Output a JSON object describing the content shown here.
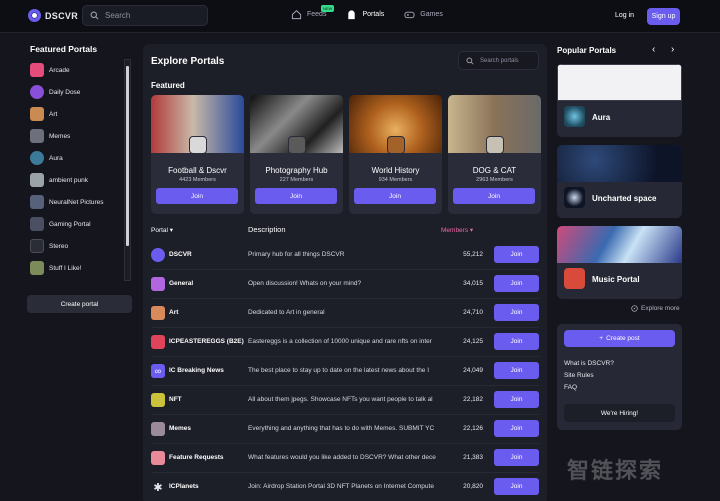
{
  "header": {
    "brand": "DSCVR",
    "search_placeholder": "Search",
    "tabs": [
      {
        "label": "Feeds",
        "badge": "NEW"
      },
      {
        "label": "Portals"
      },
      {
        "label": "Games"
      }
    ],
    "login": "Log in",
    "signup": "Sign up"
  },
  "sidebar": {
    "title": "Featured Portals",
    "items": [
      {
        "label": "Arcade",
        "color": "#e44d7b"
      },
      {
        "label": "Daily Dose",
        "color": "#8a4fd8"
      },
      {
        "label": "Art",
        "color": "#c98b52"
      },
      {
        "label": "Memes",
        "color": "#6d6f7c"
      },
      {
        "label": "Aura",
        "color": "#3c7a9a"
      },
      {
        "label": "ambient punk",
        "color": "#9aa3a8"
      },
      {
        "label": "NeuralNet Pictures",
        "color": "#58617a"
      },
      {
        "label": "Gaming Portal",
        "color": "#4a4f62"
      },
      {
        "label": "Stereo",
        "color": "#2a2c36"
      },
      {
        "label": "Stuff I Like!",
        "color": "#7b8b5a"
      }
    ],
    "create_portal": "Create portal"
  },
  "main": {
    "title": "Explore Portals",
    "search_placeholder": "Search portals",
    "featured_label": "Featured",
    "featured": [
      {
        "name": "Football & Dscvr",
        "members": "4423 Members",
        "join": "Join",
        "banner": "#a83a3a",
        "banner2": "#2a4a9a",
        "avatar": "#d9d9d9"
      },
      {
        "name": "Photography Hub",
        "members": "227 Members",
        "join": "Join",
        "banner": "#6b6b6b",
        "banner2": "#111111",
        "avatar": "#5a5a5a"
      },
      {
        "name": "World History",
        "members": "934 Members",
        "join": "Join",
        "banner": "#c9762f",
        "banner2": "#7a3c14",
        "avatar": "#a3622a"
      },
      {
        "name": "DOG & CAT",
        "members": "2963 Members",
        "join": "Join",
        "banner": "#8a7a62",
        "banner2": "#c9b590",
        "avatar": "#c7c0b5"
      }
    ],
    "table": {
      "col_portal": "Portal",
      "col_description": "Description",
      "col_members": "Members",
      "rows": [
        {
          "name": "DSCVR",
          "description": "Primary hub for all things DSCVR",
          "members": "55,212",
          "join": "Join",
          "color": "#6b5cf0"
        },
        {
          "name": "General",
          "description": "Open discussion! Whats on your mind?",
          "members": "34,015",
          "join": "Join",
          "color": "#b267e0"
        },
        {
          "name": "Art",
          "description": "Dedicated to Art in general",
          "members": "24,710",
          "join": "Join",
          "color": "#d88a5a"
        },
        {
          "name": "ICPEASTEREGGS (B2E)",
          "description": "Eastereggs is a collection of 10000 unique and rare nfts on inter",
          "members": "24,125",
          "join": "Join",
          "color": "#e0445a"
        },
        {
          "name": "IC Breaking News",
          "description": "The best place to stay up to date on the latest news about the I",
          "members": "24,049",
          "join": "Join",
          "color": "#6b5cf0"
        },
        {
          "name": "NFT",
          "description": "All about them jpegs. Showcase NFTs you want people to talk al",
          "members": "22,182",
          "join": "Join",
          "color": "#c9c23a"
        },
        {
          "name": "Memes",
          "description": "Everything and anything that has to do with Memes. SUBMIT YC",
          "members": "22,126",
          "join": "Join",
          "color": "#9a8a9a"
        },
        {
          "name": "Feature Requests",
          "description": "What features would you like added to DSCVR? What other dece",
          "members": "21,383",
          "join": "Join",
          "color": "#e88a9a"
        },
        {
          "name": "ICPlanets",
          "description": "Join: Airdrop Station Portal 3D NFT Planets on Internet Compute",
          "members": "20,820",
          "join": "Join",
          "color": "#e6e7ee"
        }
      ]
    }
  },
  "right": {
    "title": "Popular Portals",
    "portals": [
      {
        "name": "Aura",
        "banner": "#f2f2f5",
        "icon": "#2e6b8a"
      },
      {
        "name": "Uncharted space",
        "banner": "#1a2a4a",
        "icon": "#0e1424"
      },
      {
        "name": "Music Portal",
        "banner": "#3a6ab0",
        "icon": "#d84a3a"
      }
    ],
    "explore_more": "Explore more",
    "create_post": "Create post",
    "links": [
      "What is DSCVR?",
      "Site Rules",
      "FAQ"
    ],
    "hiring": "We're Hiring!"
  },
  "watermark": "智链探索"
}
